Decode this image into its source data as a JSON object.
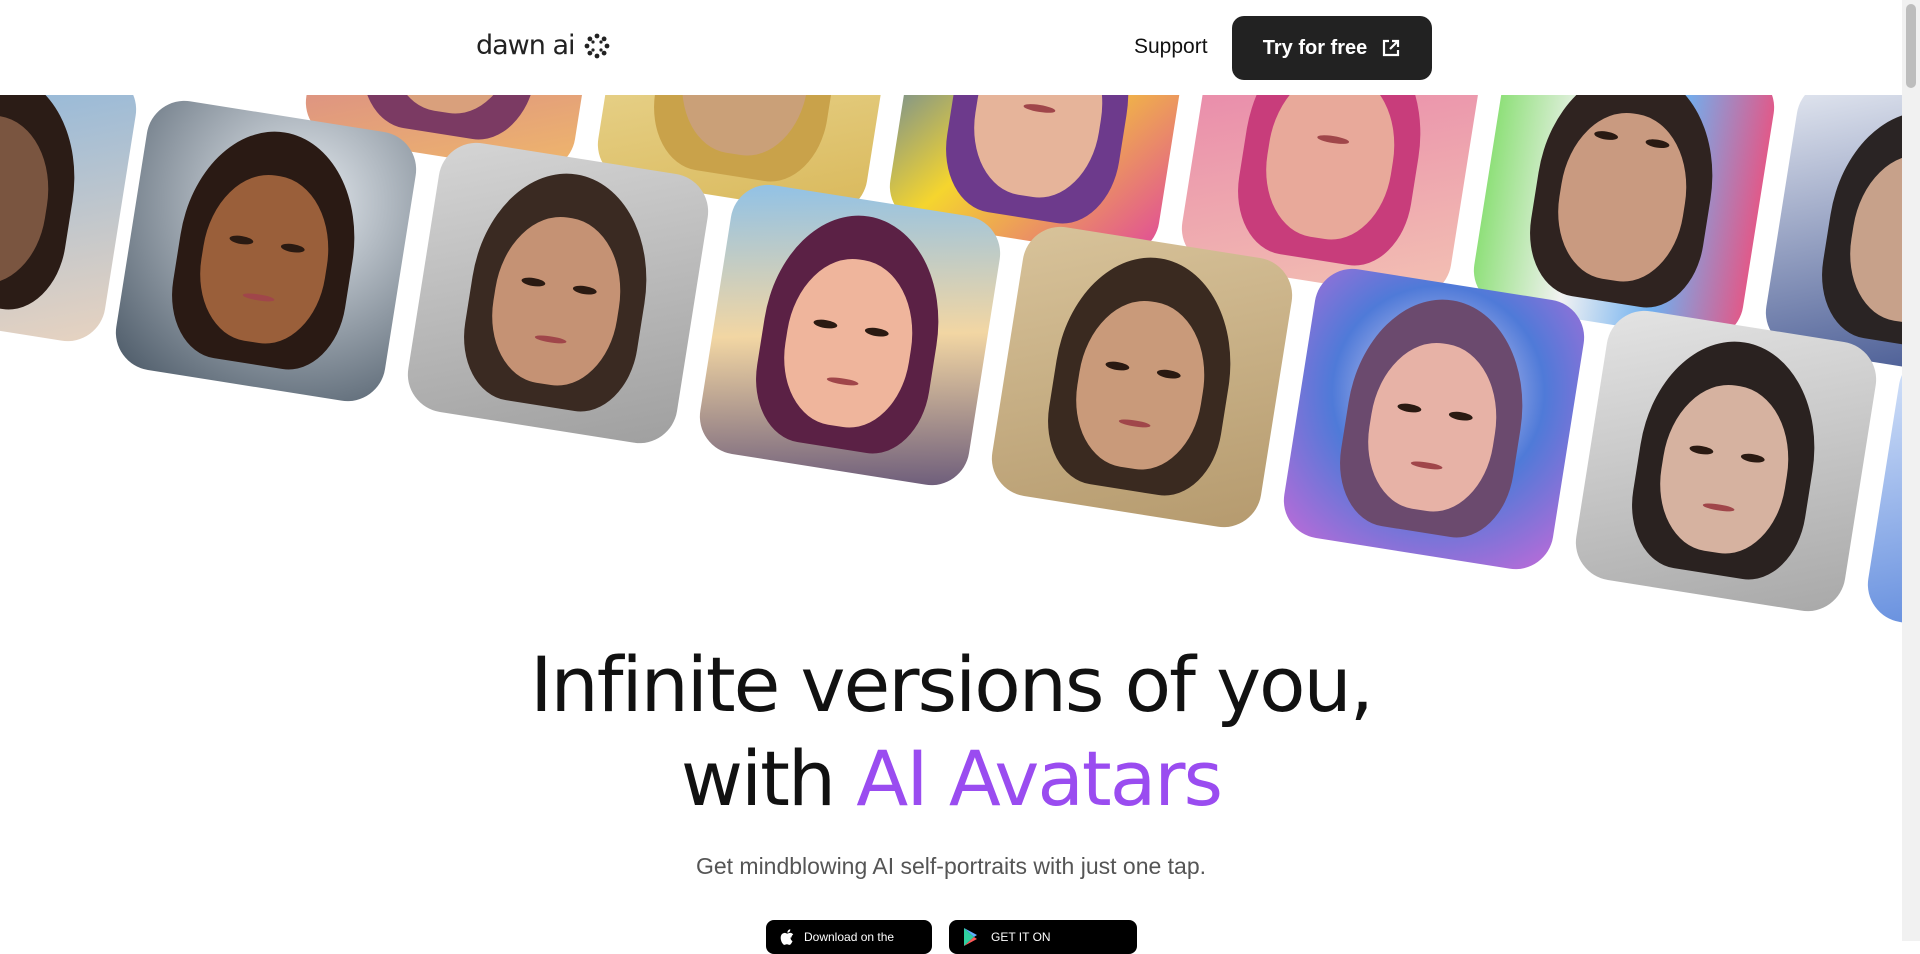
{
  "header": {
    "logo_text": "dawn ai",
    "support_label": "Support",
    "cta_label": "Try for free"
  },
  "hero": {
    "title_line1": "Infinite versions of you,",
    "title_line2_prefix": "with ",
    "title_line2_accent": "AI Avatars",
    "subtitle": "Get mindblowing AI self-portraits with just one tap.",
    "app_store_label": "Download on the",
    "play_store_label": "GET IT ON"
  },
  "colors": {
    "accent": "#9a4cf0",
    "cta_bg": "#222222",
    "text": "#111111",
    "subtitle": "#555555"
  },
  "icons": {
    "logo": "sparkle-ring-icon",
    "cta": "external-link-icon",
    "apple": "apple-icon",
    "google": "google-play-icon"
  }
}
